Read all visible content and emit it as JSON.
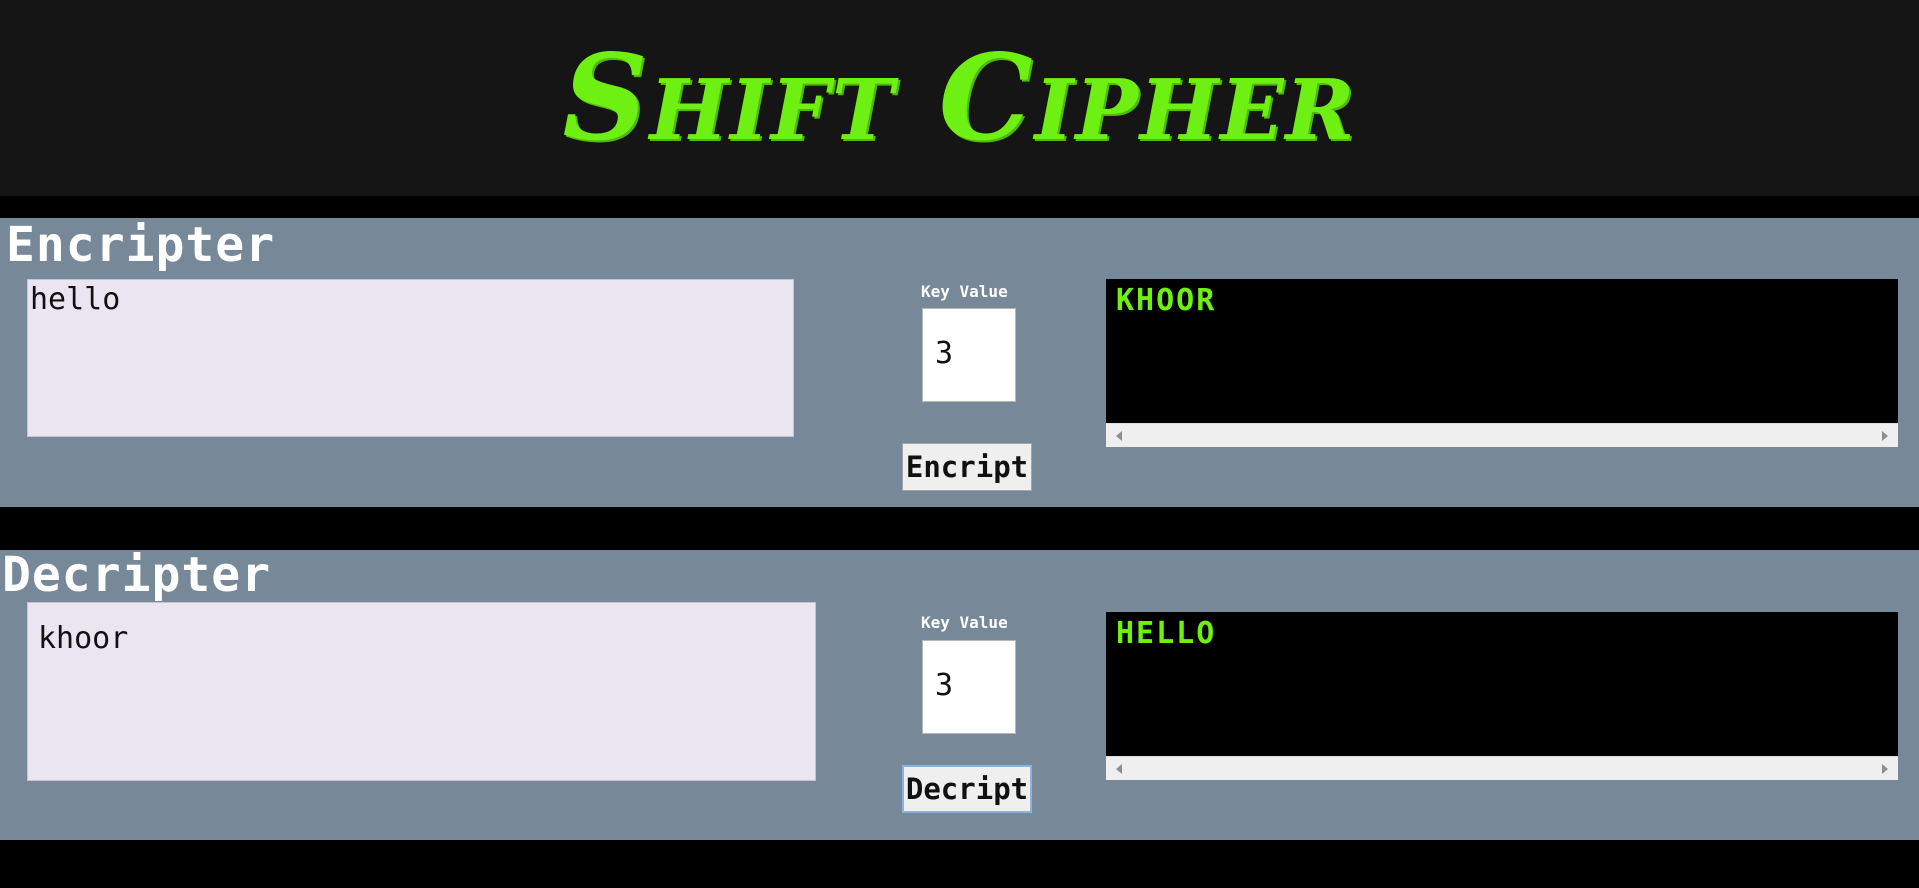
{
  "app": {
    "title": "Shift Cipher"
  },
  "encrypter": {
    "heading": "Encripter",
    "input_value": "hello",
    "key_label": "Key Value",
    "key_value": "3",
    "button_label": "Encript",
    "output_value": "KHOOR"
  },
  "decrypter": {
    "heading": "Decripter",
    "input_value": "khoor",
    "key_label": "Key Value",
    "key_value": "3",
    "button_label": "Decript",
    "output_value": "HELLO"
  },
  "colors": {
    "accent_green": "#6ef012",
    "section_bg": "#778899",
    "header_bg": "#151515",
    "input_bg": "#ebe5f2"
  },
  "icons": {
    "scroll_left": "scroll-left-arrow-icon",
    "scroll_right": "scroll-right-arrow-icon"
  }
}
